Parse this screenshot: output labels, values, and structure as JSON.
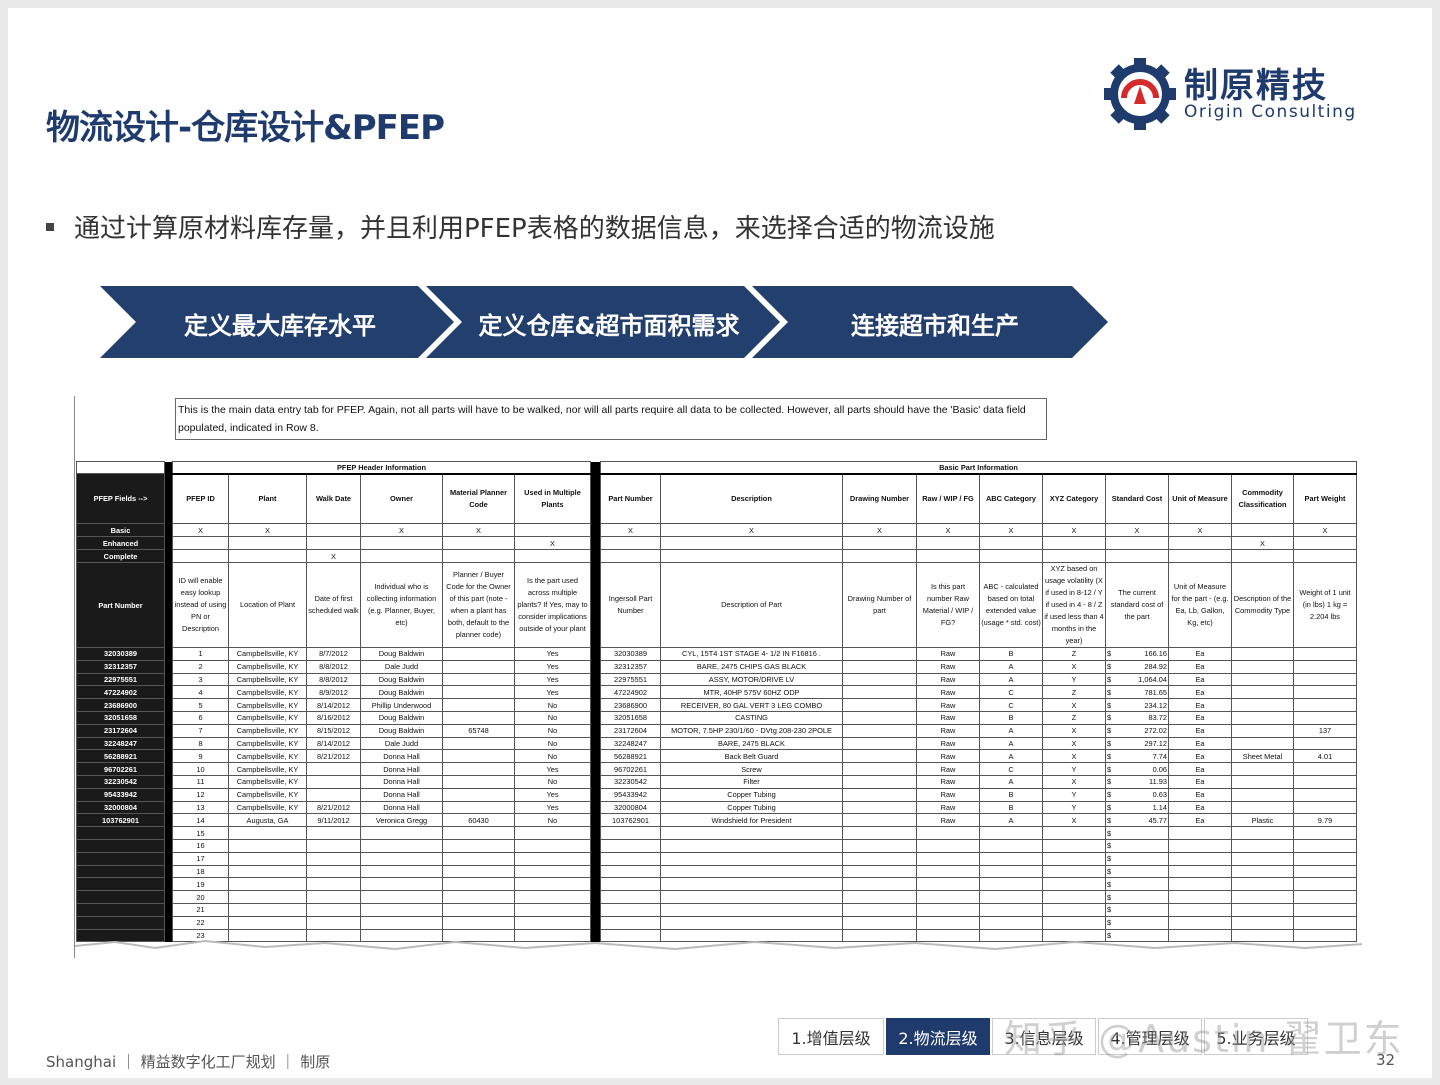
{
  "header": {
    "title": "物流设计-仓库设计&PFEP",
    "logo_cn": "制原精技",
    "logo_en": "Origin Consulting"
  },
  "bullet": "通过计算原材料库存量，并且利用PFEP表格的数据信息，来选择合适的物流设施",
  "flow_steps": [
    "定义最大库存水平",
    "定义仓库&超市面积需求",
    "连接超市和生产"
  ],
  "colors": {
    "brand_navy": "#1f3b6e",
    "flow_navy": "#233f6e",
    "logo_red": "#d42a2a"
  },
  "sheet": {
    "note": "This is the main data entry tab for PFEP.  Again, not all parts will have to be walked, nor will all parts require all data to be collected.  However, all parts should have the 'Basic' data field populated, indicated in Row 8.",
    "group_left": "PFEP Header Information",
    "group_right": "Basic Part Information",
    "fields_label": "PFEP Fields -->",
    "headers_left": [
      "PFEP ID",
      "Plant",
      "Walk Date",
      "Owner",
      "Material Planner Code",
      "Used in Multiple Plants"
    ],
    "headers_right": [
      "Part Number",
      "Description",
      "Drawing Number",
      "Raw / WIP / FG",
      "ABC Category",
      "XYZ  Category",
      "Standard Cost",
      "Unit of Measure",
      "Commodity Classification",
      "Part Weight"
    ],
    "level_rows": [
      {
        "label": "Basic",
        "left": [
          "X",
          "X",
          "",
          "X",
          "X",
          ""
        ],
        "right": [
          "X",
          "X",
          "X",
          "X",
          "X",
          "X",
          "X",
          "X",
          "",
          "X"
        ]
      },
      {
        "label": "Enhanced",
        "left": [
          "",
          "",
          "",
          "",
          "",
          "X"
        ],
        "right": [
          "",
          "",
          "",
          "",
          "",
          "",
          "",
          "",
          "X",
          ""
        ]
      },
      {
        "label": "Complete",
        "left": [
          "",
          "",
          "X",
          "",
          "",
          ""
        ],
        "right": [
          "",
          "",
          "",
          "",
          "",
          "",
          "",
          "",
          "",
          ""
        ]
      }
    ],
    "desc_label": "Part Number",
    "desc_left": [
      "ID will enable easy lookup instead of using PN or Description",
      "Location of Plant",
      "Date of first scheduled walk",
      "Individual who is collecting information (e.g. Planner, Buyer, etc)",
      "Planner / Buyer Code for the Owner of this part (note - when a plant has both, default to the planner code)",
      "Is the part used across multiple plants?  If Yes, may  to consider implications outside of your plant"
    ],
    "desc_right": [
      "Ingersoll Part Number",
      "Description of Part",
      "Drawing Number of part",
      "Is this part number Raw Material / WIP / FG?",
      "ABC - calculated based on total extended value (usage * std. cost)",
      "XYZ based on usage volatility (X if used in 8-12 / Y if used in 4 - 8 / Z if used less than 4 months in the year)",
      "The current standard cost of the part",
      "Unit of Measure for the part - (e.g. Ea, Lb, Gallon, Kg, etc)",
      "Description of the Commodity Type",
      "Weight of 1 unit (in lbs) 1 kg = 2.204 lbs"
    ],
    "rows": [
      {
        "pn": "32030389",
        "id": "1",
        "plant": "Campbellsville, KY",
        "walk": "8/7/2012",
        "owner": "Doug Baldwin",
        "mpc": "",
        "multi": "Yes",
        "part": "32030389",
        "desc": "CYL, 15T4 1ST STAGE 4- 1/2 IN      F16816   .",
        "draw": "",
        "raw": "Raw",
        "abc": "B",
        "xyz": "Z",
        "cost": "166.16",
        "uom": "Ea",
        "comm": "",
        "wt": ""
      },
      {
        "pn": "32312357",
        "id": "2",
        "plant": "Campbellsville, KY",
        "walk": "8/8/2012",
        "owner": "Dale Judd",
        "mpc": "",
        "multi": "Yes",
        "part": "32312357",
        "desc": "BARE, 2475 CHIPS GAS BLACK",
        "draw": "",
        "raw": "Raw",
        "abc": "A",
        "xyz": "X",
        "cost": "284.92",
        "uom": "Ea",
        "comm": "",
        "wt": ""
      },
      {
        "pn": "22975551",
        "id": "3",
        "plant": "Campbellsville, KY",
        "walk": "8/8/2012",
        "owner": "Doug Baldwin",
        "mpc": "",
        "multi": "Yes",
        "part": "22975551",
        "desc": "ASSY, MOTOR/DRIVE LV",
        "draw": "",
        "raw": "Raw",
        "abc": "A",
        "xyz": "Y",
        "cost": "1,064.04",
        "uom": "Ea",
        "comm": "",
        "wt": ""
      },
      {
        "pn": "47224902",
        "id": "4",
        "plant": "Campbellsville, KY",
        "walk": "8/9/2012",
        "owner": "Doug Baldwin",
        "mpc": "",
        "multi": "Yes",
        "part": "47224902",
        "desc": "MTR, 40HP 575V 60HZ ODP",
        "draw": "",
        "raw": "Raw",
        "abc": "C",
        "xyz": "Z",
        "cost": "781.65",
        "uom": "Ea",
        "comm": "",
        "wt": ""
      },
      {
        "pn": "23686900",
        "id": "5",
        "plant": "Campbellsville, KY",
        "walk": "8/14/2012",
        "owner": "Phillip Underwood",
        "mpc": "",
        "multi": "No",
        "part": "23686900",
        "desc": "RECEIVER, 80 GAL VERT 3 LEG COMBO",
        "draw": "",
        "raw": "Raw",
        "abc": "C",
        "xyz": "X",
        "cost": "234.12",
        "uom": "Ea",
        "comm": "",
        "wt": ""
      },
      {
        "pn": "32051658",
        "id": "6",
        "plant": "Campbellsville, KY",
        "walk": "8/16/2012",
        "owner": "Doug Baldwin",
        "mpc": "",
        "multi": "No",
        "part": "32051658",
        "desc": "CASTING",
        "draw": "",
        "raw": "Raw",
        "abc": "B",
        "xyz": "Z",
        "cost": "83.72",
        "uom": "Ea",
        "comm": "",
        "wt": ""
      },
      {
        "pn": "23172604",
        "id": "7",
        "plant": "Campbellsville, KY",
        "walk": "8/15/2012",
        "owner": "Doug Baldwin",
        "mpc": "65748",
        "multi": "No",
        "part": "23172604",
        "desc": "MOTOR, 7.5HP 230/1/60 - DVtg 208-230 2POLE",
        "draw": "",
        "raw": "Raw",
        "abc": "A",
        "xyz": "X",
        "cost": "272.02",
        "uom": "Ea",
        "comm": "",
        "wt": "137"
      },
      {
        "pn": "32248247",
        "id": "8",
        "plant": "Campbellsville, KY",
        "walk": "8/14/2012",
        "owner": "Dale Judd",
        "mpc": "",
        "multi": "No",
        "part": "32248247",
        "desc": "BARE, 2475 BLACK",
        "draw": "",
        "raw": "Raw",
        "abc": "A",
        "xyz": "X",
        "cost": "297.12",
        "uom": "Ea",
        "comm": "",
        "wt": ""
      },
      {
        "pn": "56288921",
        "id": "9",
        "plant": "Campbellsville, KY",
        "walk": "8/21/2012",
        "owner": "Donna Hall",
        "mpc": "",
        "multi": "No",
        "part": "56288921",
        "desc": "Back Belt Guard",
        "draw": "",
        "raw": "Raw",
        "abc": "A",
        "xyz": "X",
        "cost": "7.74",
        "uom": "Ea",
        "comm": "Sheet Metal",
        "wt": "4.01"
      },
      {
        "pn": "96702261",
        "id": "10",
        "plant": "Campbellsville, KY",
        "walk": "",
        "owner": "Donna Hall",
        "mpc": "",
        "multi": "Yes",
        "part": "96702261",
        "desc": "Screw",
        "draw": "",
        "raw": "Raw",
        "abc": "C",
        "xyz": "Y",
        "cost": "0.06",
        "uom": "Ea",
        "comm": "",
        "wt": ""
      },
      {
        "pn": "32230542",
        "id": "11",
        "plant": "Campbellsville, KY",
        "walk": "",
        "owner": "Donna Hall",
        "mpc": "",
        "multi": "No",
        "part": "32230542",
        "desc": "Filter",
        "draw": "",
        "raw": "Raw",
        "abc": "A",
        "xyz": "X",
        "cost": "11.93",
        "uom": "Ea",
        "comm": "",
        "wt": ""
      },
      {
        "pn": "95433942",
        "id": "12",
        "plant": "Campbellsville, KY",
        "walk": "",
        "owner": "Donna Hall",
        "mpc": "",
        "multi": "Yes",
        "part": "95433942",
        "desc": "Copper Tubing",
        "draw": "",
        "raw": "Raw",
        "abc": "B",
        "xyz": "Y",
        "cost": "0.63",
        "uom": "Ea",
        "comm": "",
        "wt": ""
      },
      {
        "pn": "32000804",
        "id": "13",
        "plant": "Campbellsville, KY",
        "walk": "8/21/2012",
        "owner": "Donna Hall",
        "mpc": "",
        "multi": "Yes",
        "part": "32000804",
        "desc": "Copper Tubing",
        "draw": "",
        "raw": "Raw",
        "abc": "B",
        "xyz": "Y",
        "cost": "1.14",
        "uom": "Ea",
        "comm": "",
        "wt": ""
      },
      {
        "pn": "103762901",
        "id": "14",
        "plant": "Augusta, GA",
        "walk": "9/11/2012",
        "owner": "Veronica Gregg",
        "mpc": "60430",
        "multi": "No",
        "part": "103762901",
        "desc": "Windshield for President",
        "draw": "",
        "raw": "Raw",
        "abc": "A",
        "xyz": "X",
        "cost": "45.77",
        "uom": "Ea",
        "comm": "Plastic",
        "wt": "9.79"
      }
    ],
    "empty_ids": [
      "15",
      "16",
      "17",
      "18",
      "19",
      "20",
      "21",
      "22",
      "23"
    ],
    "currency": "$"
  },
  "footer": "Shanghai ｜ 精益数字化工厂规划  ｜ 制原",
  "tabs": [
    {
      "label": "1.增值层级",
      "active": false
    },
    {
      "label": "2.物流层级",
      "active": true
    },
    {
      "label": "3.信息层级",
      "active": false
    },
    {
      "label": "4.管理层级",
      "active": false
    },
    {
      "label": "5.业务层级",
      "active": false
    }
  ],
  "watermark": "知乎 @Austin 翟卫东",
  "page_number": "32"
}
